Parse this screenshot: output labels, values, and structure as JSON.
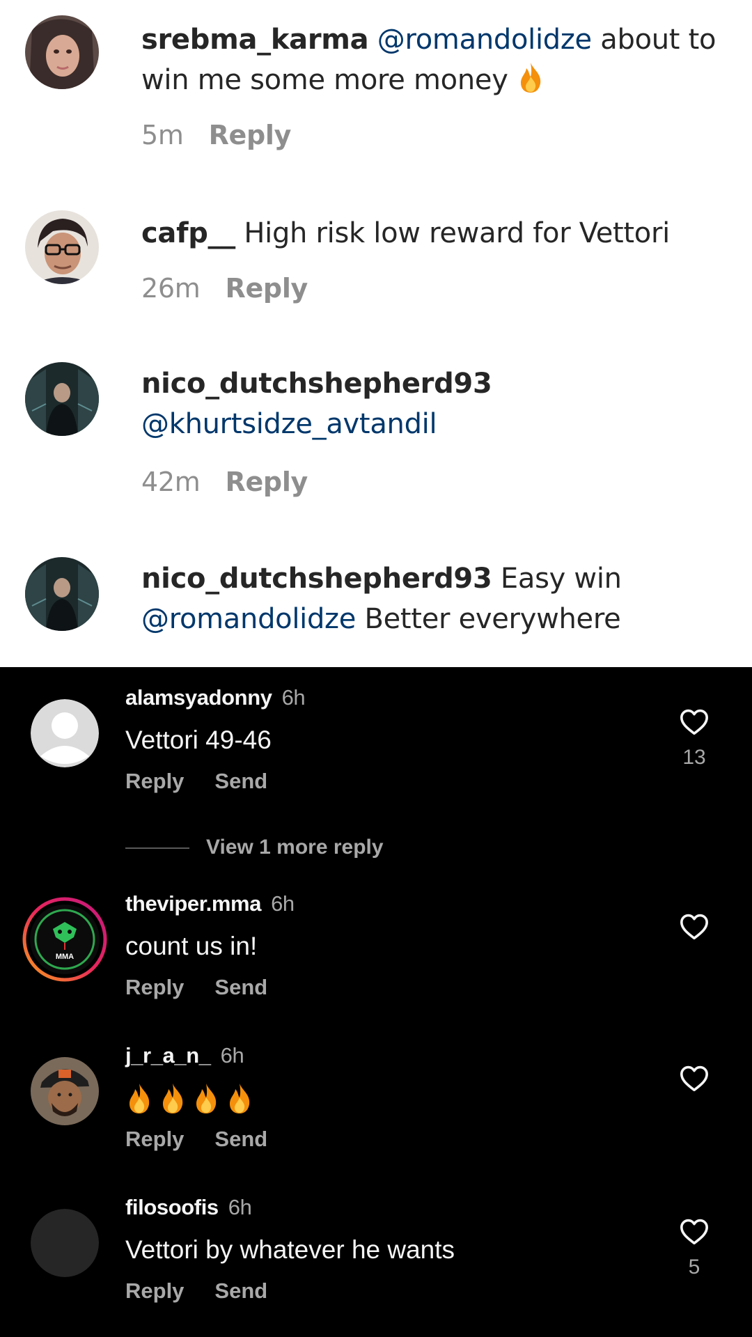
{
  "light_comments": [
    {
      "username": "srebma_karma",
      "mention": "@romandolidze",
      "text": " about to win me some more money ",
      "emoji": "fire",
      "time": "5m",
      "reply": "Reply"
    },
    {
      "username": "cafp__",
      "text": " High risk low reward for Vettori",
      "time": "26m",
      "reply": "Reply"
    },
    {
      "username": "nico_dutchshepherd93",
      "mention": "@khurtsidze_avtandil",
      "time": "42m",
      "reply": "Reply"
    },
    {
      "username": "nico_dutchshepherd93",
      "text": " Easy win ",
      "mention": "@romandolidze",
      "text2": " Better everywhere"
    }
  ],
  "dark_comments": [
    {
      "username": "alamsyadonny",
      "time": "6h",
      "text": "Vettori 49-46",
      "reply": "Reply",
      "send": "Send",
      "likes": "13",
      "view_more": "View 1 more reply"
    },
    {
      "username": "theviper.mma",
      "time": "6h",
      "text": "count us in!",
      "reply": "Reply",
      "send": "Send",
      "avatar_text": "MMA"
    },
    {
      "username": "j_r_a_n_",
      "time": "6h",
      "emoji": "fire x4",
      "reply": "Reply",
      "send": "Send"
    },
    {
      "username": "filosoofis",
      "time": "6h",
      "text": "Vettori by whatever he wants",
      "reply": "Reply",
      "send": "Send",
      "likes": "5"
    }
  ],
  "colors": {
    "light_bg": "#ffffff",
    "dark_bg": "#000000",
    "mention": "#00376b",
    "muted": "#8e8e8e",
    "dark_muted": "#a8a8a8"
  }
}
